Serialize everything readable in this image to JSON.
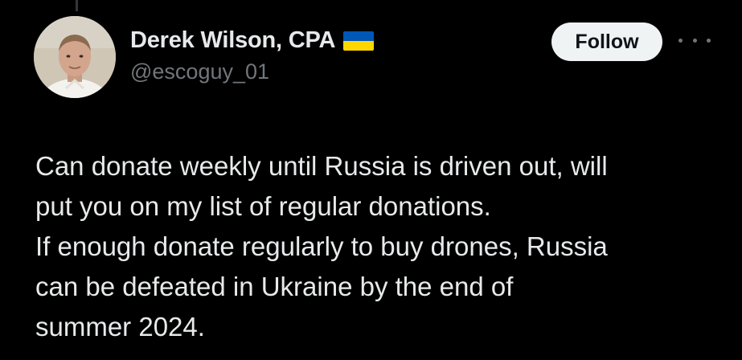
{
  "tweet": {
    "author": {
      "display_name": "Derek Wilson, CPA",
      "handle": "@escoguy_01",
      "badge_icon": "ukraine-flag-icon",
      "badge_colors": {
        "top": "#0057B7",
        "bottom": "#FFD700"
      }
    },
    "follow_label": "Follow",
    "more_icon": "more-options-icon",
    "body_lines": [
      "Can donate weekly until Russia is driven out, will",
      "put you on my list of regular donations.",
      "If enough donate regularly to buy drones, Russia",
      "can be defeated in Ukraine by the end of",
      "summer 2024."
    ]
  },
  "theme": {
    "background": "#000000",
    "text_primary": "#e7e9ea",
    "text_secondary": "#71767b",
    "follow_bg": "#eff3f4",
    "follow_text": "#0f1419"
  }
}
